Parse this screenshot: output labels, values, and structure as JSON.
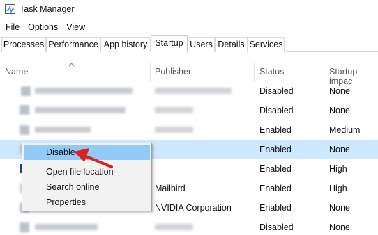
{
  "window": {
    "title": "Task Manager",
    "icon": "task-manager-icon"
  },
  "menubar": {
    "items": [
      "File",
      "Options",
      "View"
    ]
  },
  "tabs": [
    "Processes",
    "Performance",
    "App history",
    "Startup",
    "Users",
    "Details",
    "Services"
  ],
  "active_tab": "Startup",
  "columns": {
    "name": "Name",
    "publisher": "Publisher",
    "status": "Status",
    "impact": "Startup impac"
  },
  "rows": [
    {
      "publisher": "",
      "status": "Disabled",
      "impact": "None"
    },
    {
      "publisher": "",
      "status": "Disabled",
      "impact": "None"
    },
    {
      "publisher": "",
      "status": "Enabled",
      "impact": "Medium"
    },
    {
      "publisher": "",
      "status": "Enabled",
      "impact": "None"
    },
    {
      "publisher": "",
      "status": "Enabled",
      "impact": "High"
    },
    {
      "publisher": "Mailbird",
      "status": "Enabled",
      "impact": "High"
    },
    {
      "publisher": "NVIDIA Corporation",
      "status": "Enabled",
      "impact": "None"
    },
    {
      "publisher": "",
      "status": "Disabled",
      "impact": "None"
    }
  ],
  "context_menu": {
    "items": [
      "Disable",
      "Open file location",
      "Search online",
      "Properties"
    ],
    "highlighted": "Disable"
  },
  "colors": {
    "selection": "#cce8ff",
    "menu_highlight": "#91c9f7",
    "arrow": "#e02020"
  }
}
